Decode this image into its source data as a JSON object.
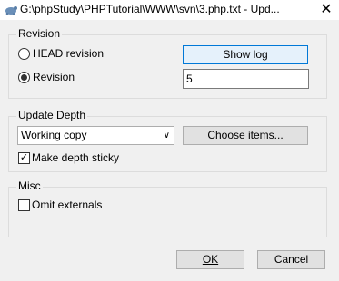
{
  "window": {
    "title": "G:\\phpStudy\\PHPTutorial\\WWW\\svn\\3.php.txt - Upd...",
    "close_glyph": "✕"
  },
  "revision": {
    "group_label": "Revision",
    "head_label": "HEAD revision",
    "revision_label": "Revision",
    "selected": "revision",
    "show_log_label": "Show log",
    "revision_value": "5"
  },
  "update_depth": {
    "group_label": "Update Depth",
    "depth_value": "Working copy",
    "choose_items_label": "Choose items...",
    "sticky_label": "Make depth sticky",
    "sticky_checked": true,
    "check_glyph": "✓"
  },
  "misc": {
    "group_label": "Misc",
    "omit_externals_label": "Omit externals",
    "omit_externals_checked": false
  },
  "footer": {
    "ok_label": "OK",
    "cancel_label": "Cancel"
  }
}
